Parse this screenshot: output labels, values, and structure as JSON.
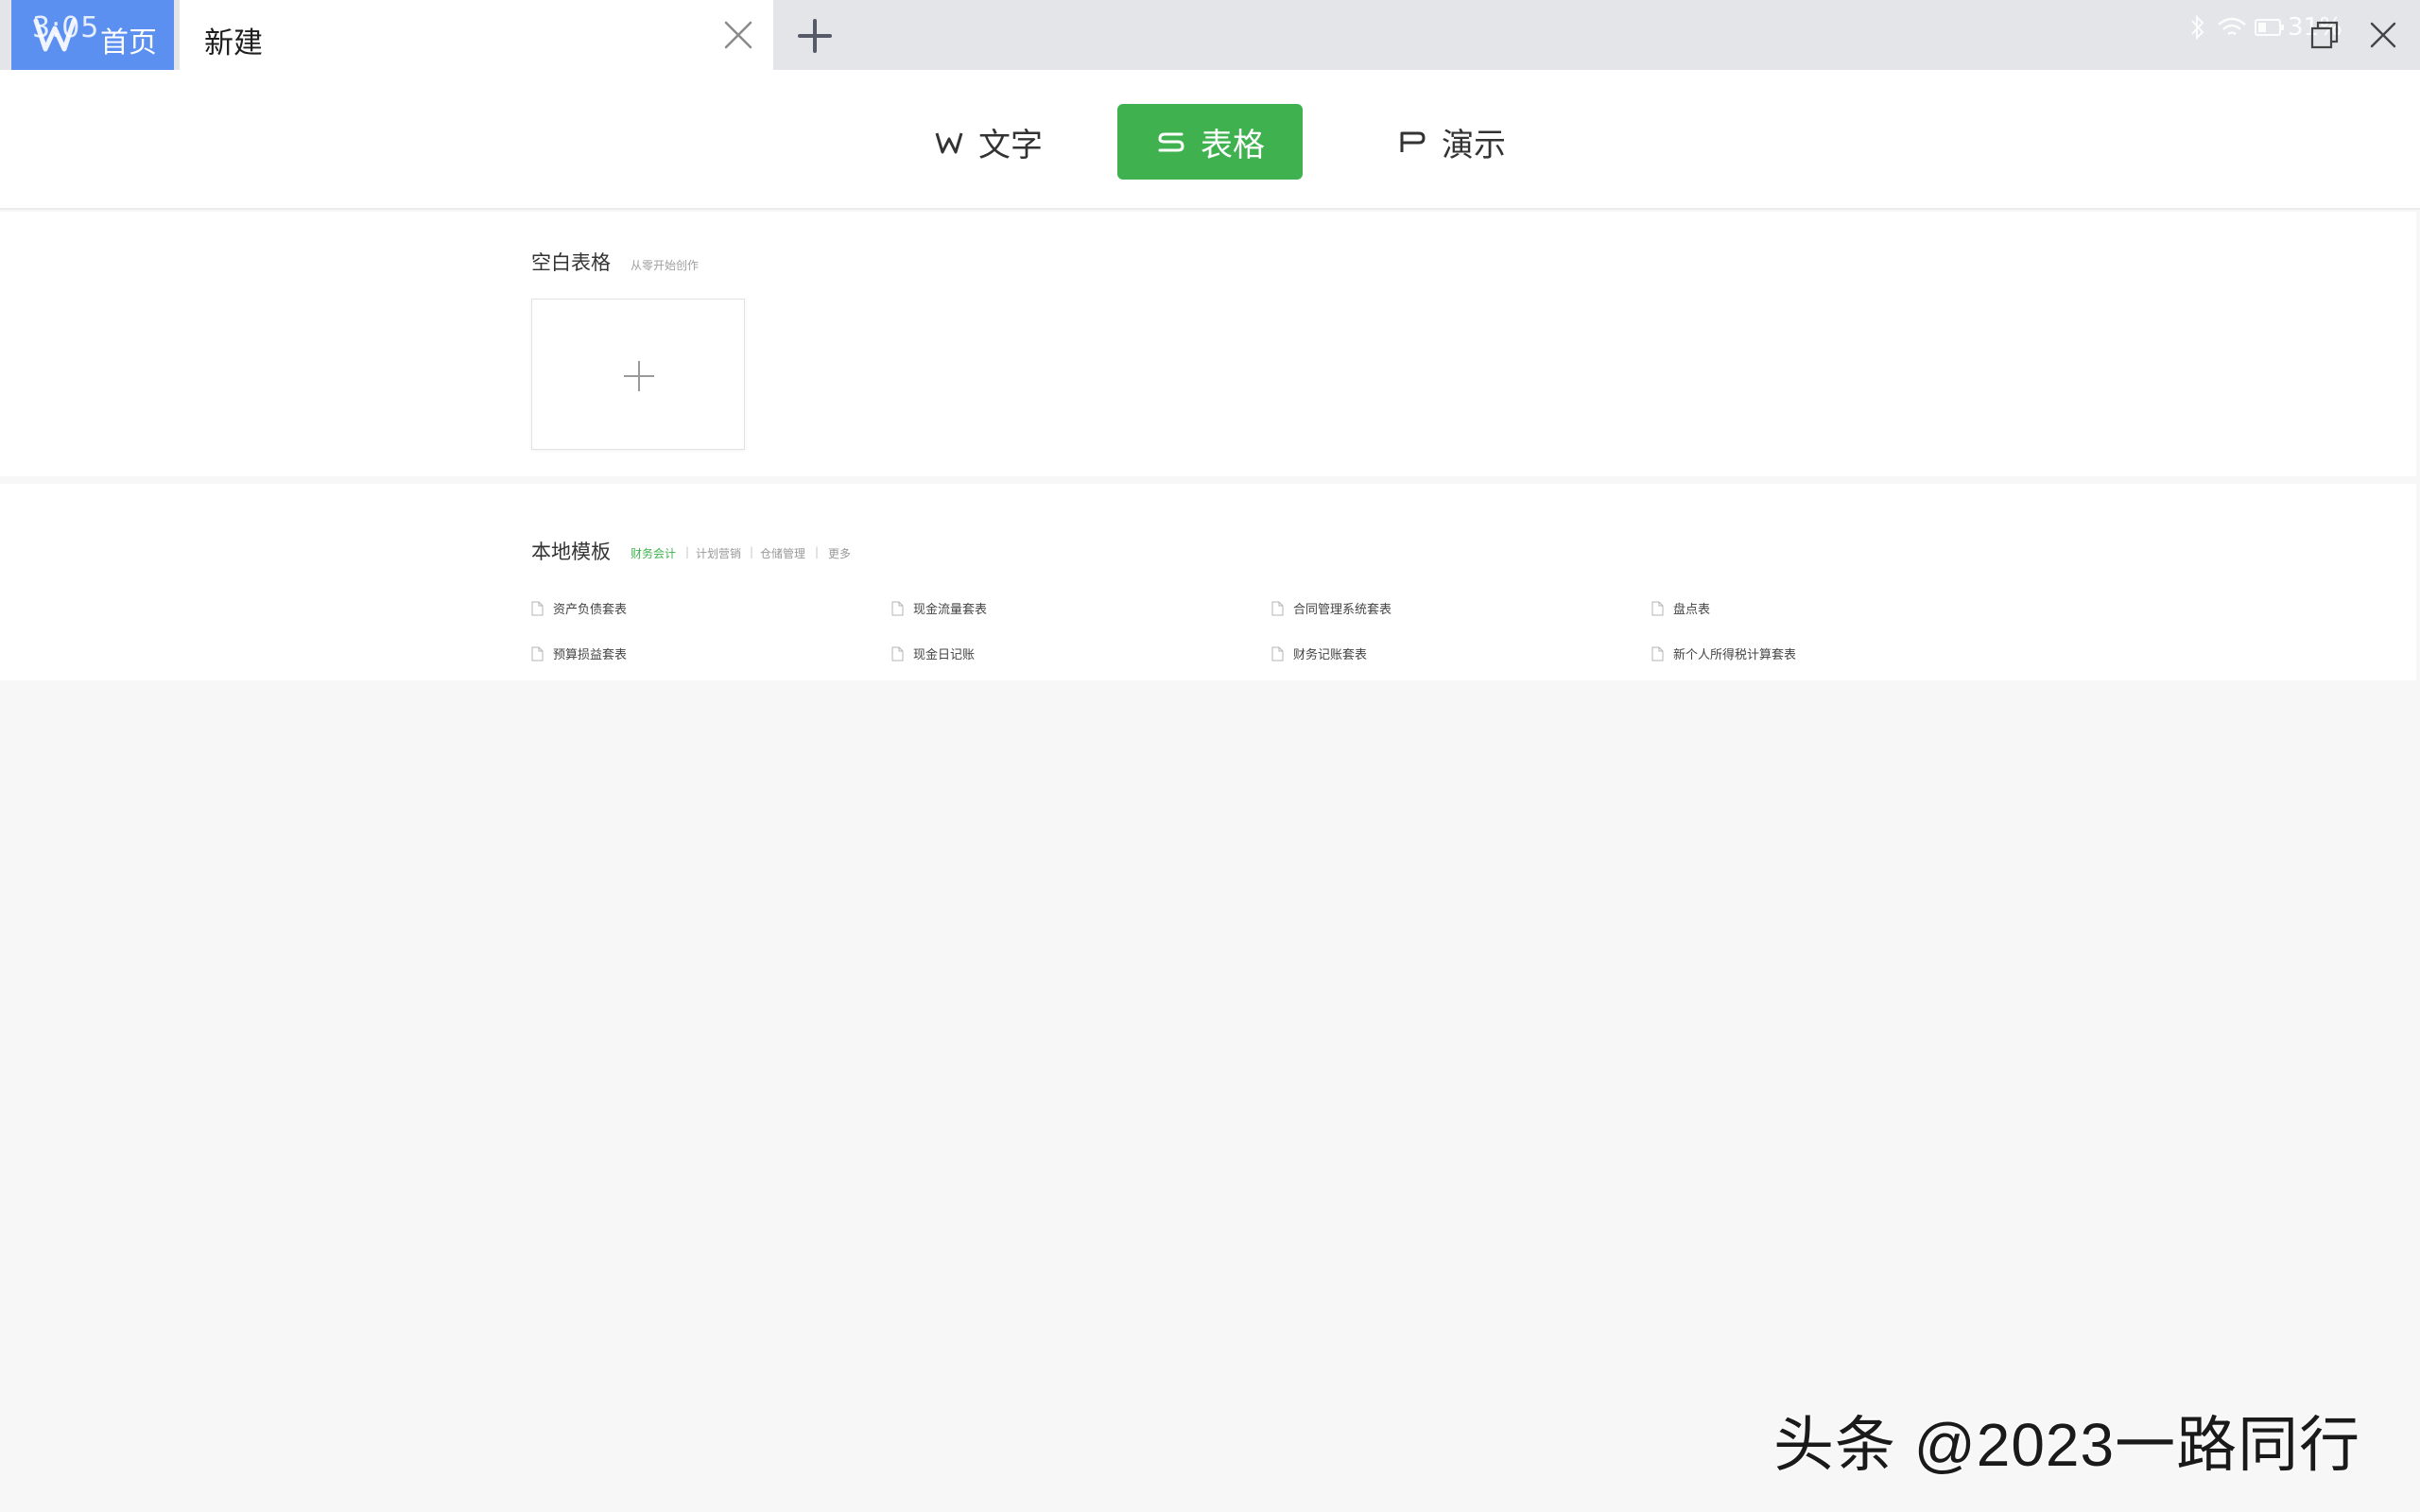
{
  "tabs": {
    "home": {
      "time": "3:05",
      "label": "首页"
    },
    "new": {
      "label": "新建"
    }
  },
  "status": {
    "battery": "31%"
  },
  "doc_types": [
    {
      "glyph": "W",
      "label": "文字",
      "active": false
    },
    {
      "glyph": "S",
      "label": "表格",
      "active": true
    },
    {
      "glyph": "P",
      "label": "演示",
      "active": false
    }
  ],
  "blank_section": {
    "title": "空白表格",
    "subtitle": "从零开始创作"
  },
  "templates_section": {
    "title": "本地模板",
    "categories": [
      {
        "label": "财务会计",
        "active": true
      },
      {
        "label": "计划营销",
        "active": false
      },
      {
        "label": "仓储管理",
        "active": false
      },
      {
        "label": "更多",
        "active": false
      }
    ],
    "separator": "|",
    "items": [
      {
        "label": "资产负债套表"
      },
      {
        "label": "现金流量套表"
      },
      {
        "label": "合同管理系统套表"
      },
      {
        "label": "盘点表"
      },
      {
        "label": "预算损益套表"
      },
      {
        "label": "现金日记账"
      },
      {
        "label": "财务记账套表"
      },
      {
        "label": "新个人所得税计算套表"
      }
    ]
  },
  "watermark": "头条 @2023一路同行",
  "colors": {
    "accent_green": "#3fb24f",
    "home_tab_blue": "#5b8ff0",
    "tabbar_bg": "#e3e5e8",
    "page_bg": "#f7f7f7"
  }
}
